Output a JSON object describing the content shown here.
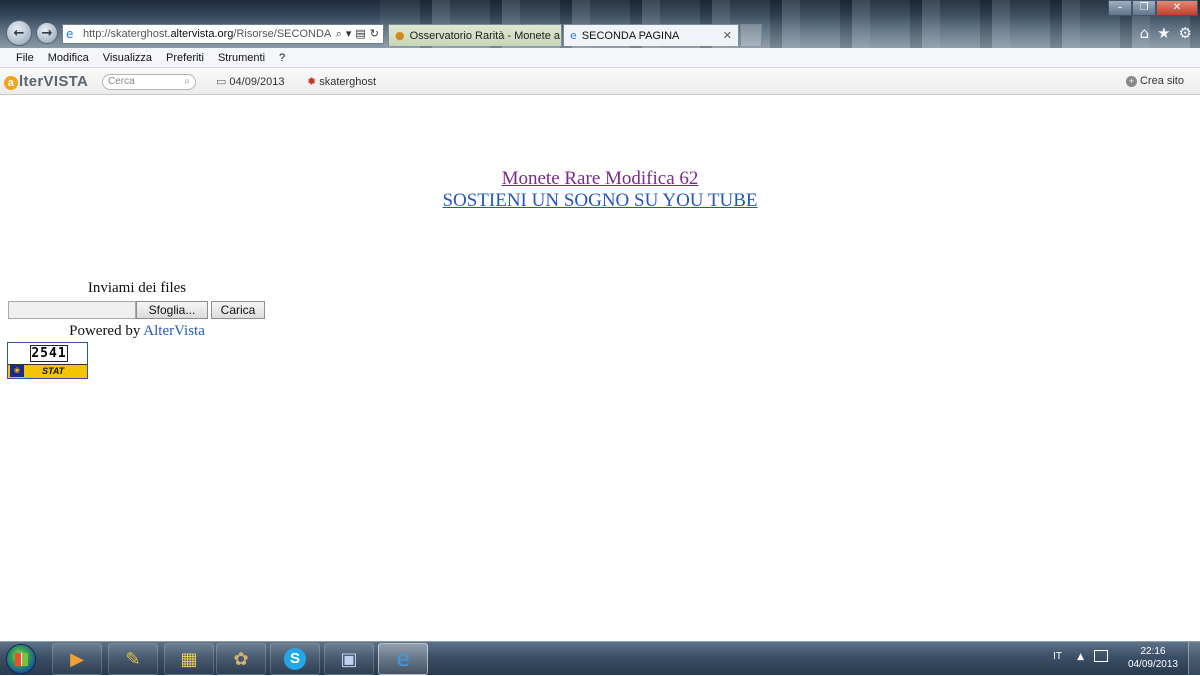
{
  "browser": {
    "address_url_prefix": "http://skaterghost.",
    "address_url_domain": "altervista.org",
    "address_url_suffix": "/Risorse/SECONDA",
    "tabs": [
      {
        "label": "Osservatorio Rarità - Monete a ...",
        "active": false
      },
      {
        "label": "SECONDA PAGINA",
        "active": true
      }
    ],
    "tab_close_glyph": "✕"
  },
  "menu": {
    "items": [
      "File",
      "Modifica",
      "Visualizza",
      "Preferiti",
      "Strumenti",
      "?"
    ]
  },
  "altervista_bar": {
    "logo_letter": "a",
    "logo_text": "lterVISTA",
    "search_placeholder": "Cerca",
    "date": "04/09/2013",
    "username": "skaterghost",
    "create_site": "Crea sito"
  },
  "page": {
    "link_1": "Monete Rare Modifica 62",
    "link_2": "SOSTIENI UN SOGNO SU YOU TUBE",
    "upload_title": "Inviami dei files",
    "browse_button": "Sfoglia...",
    "upload_button": "Carica",
    "powered_prefix": "Powered by ",
    "powered_link": "AlterVista",
    "stat_counter": "2541",
    "stat_label": "STAT"
  },
  "taskbar": {
    "language": "IT",
    "time": "22:16",
    "date": "04/09/2013"
  },
  "colors": {
    "visited_link": "#7a2a8a",
    "link": "#2458b8",
    "taskbar": "#3b4f66"
  }
}
